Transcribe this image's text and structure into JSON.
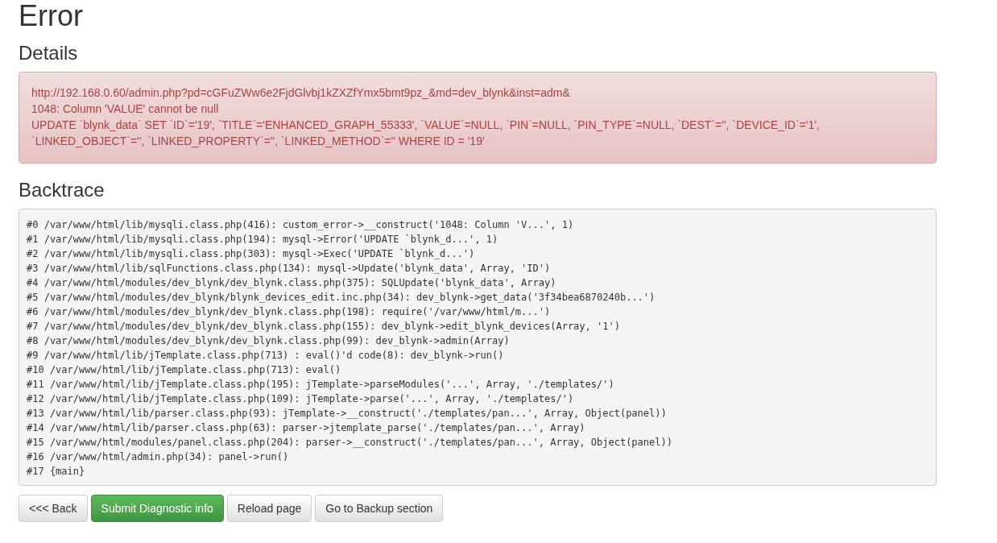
{
  "page_title": "Error",
  "details": {
    "heading": "Details",
    "lines": [
      "http://192.168.0.60/admin.php?pd=cGFuZWw6e2FjdGlvbj1kZXZfYmx5bmt9pz_&md=dev_blynk&inst=adm&",
      "1048: Column 'VALUE' cannot be null",
      "UPDATE `blynk_data` SET `ID`='19', `TITLE`='ENHANCED_GRAPH_55333', `VALUE`=NULL, `PIN`=NULL, `PIN_TYPE`=NULL, `DEST`='', `DEVICE_ID`='1', `LINKED_OBJECT`='', `LINKED_PROPERTY`='', `LINKED_METHOD`='' WHERE ID = '19'"
    ]
  },
  "backtrace": {
    "heading": "Backtrace",
    "lines": [
      "#0 /var/www/html/lib/mysqli.class.php(416): custom_error->__construct('1048: Column 'V...', 1)",
      "#1 /var/www/html/lib/mysqli.class.php(194): mysql->Error('UPDATE `blynk_d...', 1)",
      "#2 /var/www/html/lib/mysqli.class.php(303): mysql->Exec('UPDATE `blynk_d...')",
      "#3 /var/www/html/lib/sqlFunctions.class.php(134): mysql->Update('blynk_data', Array, 'ID')",
      "#4 /var/www/html/modules/dev_blynk/dev_blynk.class.php(375): SQLUpdate('blynk_data', Array)",
      "#5 /var/www/html/modules/dev_blynk/blynk_devices_edit.inc.php(34): dev_blynk->get_data('3f34bea6870240b...')",
      "#6 /var/www/html/modules/dev_blynk/dev_blynk.class.php(198): require('/var/www/html/m...')",
      "#7 /var/www/html/modules/dev_blynk/dev_blynk.class.php(155): dev_blynk->edit_blynk_devices(Array, '1')",
      "#8 /var/www/html/modules/dev_blynk/dev_blynk.class.php(99): dev_blynk->admin(Array)",
      "#9 /var/www/html/lib/jTemplate.class.php(713) : eval()'d code(8): dev_blynk->run()",
      "#10 /var/www/html/lib/jTemplate.class.php(713): eval()",
      "#11 /var/www/html/lib/jTemplate.class.php(195): jTemplate->parseModules('...', Array, './templates/')",
      "#12 /var/www/html/lib/jTemplate.class.php(109): jTemplate->parse('...', Array, './templates/')",
      "#13 /var/www/html/lib/parser.class.php(93): jTemplate->__construct('./templates/pan...', Array, Object(panel))",
      "#14 /var/www/html/lib/parser.class.php(63): parser->jtemplate_parse('./templates/pan...', Array)",
      "#15 /var/www/html/modules/panel.class.php(204): parser->__construct('./templates/pan...', Array, Object(panel))",
      "#16 /var/www/html/admin.php(34): panel->run()",
      "#17 {main}"
    ]
  },
  "buttons": [
    {
      "label": "<<< Back",
      "kind": "default"
    },
    {
      "label": "Submit Diagnostic info",
      "kind": "success"
    },
    {
      "label": "Reload page",
      "kind": "default"
    },
    {
      "label": "Go to Backup section",
      "kind": "default"
    }
  ]
}
